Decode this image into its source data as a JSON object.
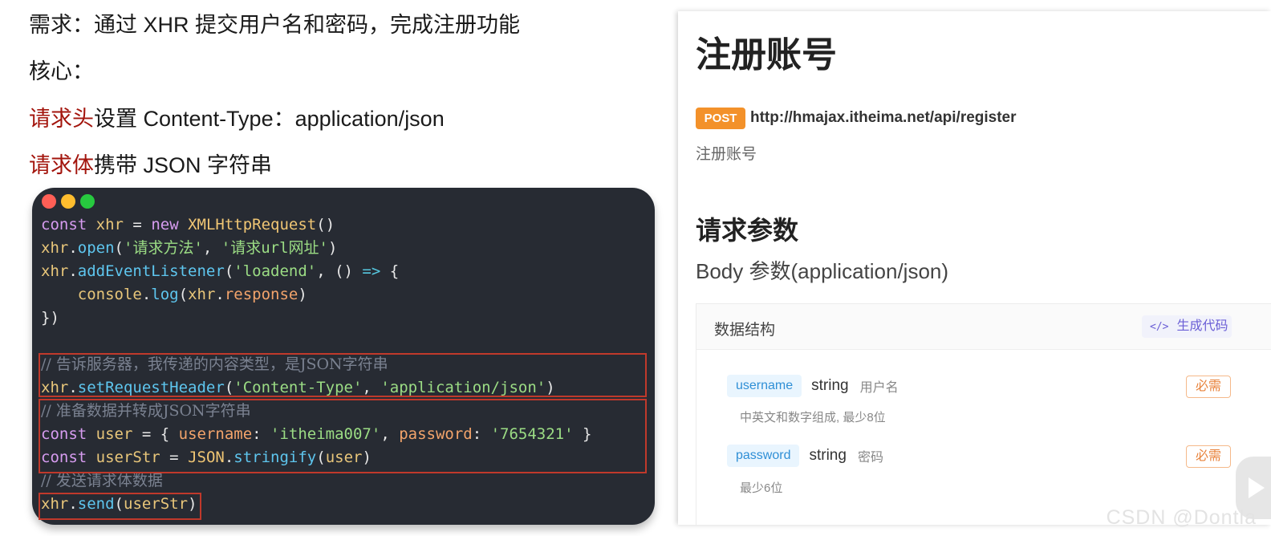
{
  "slide": {
    "line1": "需求：通过 XHR 提交用户名和密码，完成注册功能",
    "line2": "核心：",
    "line3_red": "请求头",
    "line3_rest": "设置 Content-Type：application/json",
    "line4_red": "请求体",
    "line4_rest": "携带 JSON 字符串"
  },
  "colors": {
    "dot_red": "#ff5f56",
    "dot_yellow": "#ffbd2e",
    "dot_green": "#27c93f",
    "highlight_box": "#c0392b",
    "method_badge": "#f3912a"
  },
  "code": {
    "l1": [
      "const",
      " ",
      "xhr",
      " = ",
      "new",
      " ",
      "XMLHttpRequest",
      "()"
    ],
    "l2": [
      "xhr",
      ".",
      "open",
      "(",
      "'请求方法'",
      ", ",
      "'请求url网址'",
      ")"
    ],
    "l3": [
      "xhr",
      ".",
      "addEventListener",
      "(",
      "'loadend'",
      ", () ",
      "=>",
      " {"
    ],
    "l4": [
      "    ",
      "console",
      ".",
      "log",
      "(",
      "xhr",
      ".",
      "response",
      ")"
    ],
    "l5": "})",
    "l7": "// 告诉服务器，我传递的内容类型，是JSON字符串",
    "l8": [
      "xhr",
      ".",
      "setRequestHeader",
      "(",
      "'Content-Type'",
      ", ",
      "'application/json'",
      ")"
    ],
    "l9": "// 准备数据并转成JSON字符串",
    "l10": [
      "const",
      " ",
      "user",
      " = { ",
      "username",
      ": ",
      "'itheima007'",
      ", ",
      "password",
      ": ",
      "'7654321'",
      " }"
    ],
    "l11": [
      "const",
      " ",
      "userStr",
      " = ",
      "JSON",
      ".",
      "stringify",
      "(",
      "user",
      ")"
    ],
    "l12": "// 发送请求体数据",
    "l13": [
      "xhr",
      ".",
      "send",
      "(",
      "userStr",
      ")"
    ]
  },
  "api": {
    "title": "注册账号",
    "method": "POST",
    "url": "http://hmajax.itheima.net/api/register",
    "description": "注册账号",
    "params_heading": "请求参数",
    "body_heading": "Body 参数(application/json)",
    "panel_title": "数据结构",
    "generate_code_icon": "</>",
    "generate_code_label": "生成代码",
    "params": [
      {
        "name": "username",
        "type": "string",
        "label": "用户名",
        "note": "中英文和数字组成, 最少8位",
        "required": "必需"
      },
      {
        "name": "password",
        "type": "string",
        "label": "密码",
        "note": "最少6位",
        "required": "必需"
      }
    ]
  },
  "watermark": "CSDN @Dontla"
}
